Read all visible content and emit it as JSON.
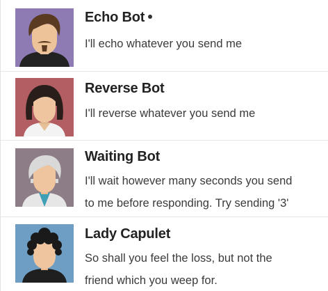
{
  "contacts": [
    {
      "name": "Echo Bot",
      "online": true,
      "avatar_icon": "bearded-man-avatar-icon",
      "avatar_bg": "#8e7bb3",
      "description_lines": [
        "I'll echo whatever you send me"
      ]
    },
    {
      "name": "Reverse Bot",
      "online": false,
      "avatar_icon": "woman-avatar-icon",
      "avatar_bg": "#b25e62",
      "description_lines": [
        "I'll reverse whatever you send me"
      ]
    },
    {
      "name": "Waiting Bot",
      "online": false,
      "avatar_icon": "old-man-avatar-icon",
      "avatar_bg": "#8c7d86",
      "description_lines": [
        "I'll wait however many seconds you send",
        "to me before responding. Try sending '3'"
      ]
    },
    {
      "name": "Lady Capulet",
      "online": false,
      "avatar_icon": "curly-haired-man-avatar-icon",
      "avatar_bg": "#6f9ec4",
      "description_lines": [
        "So shall you feel the loss, but not the",
        "friend which you weep for."
      ]
    }
  ]
}
